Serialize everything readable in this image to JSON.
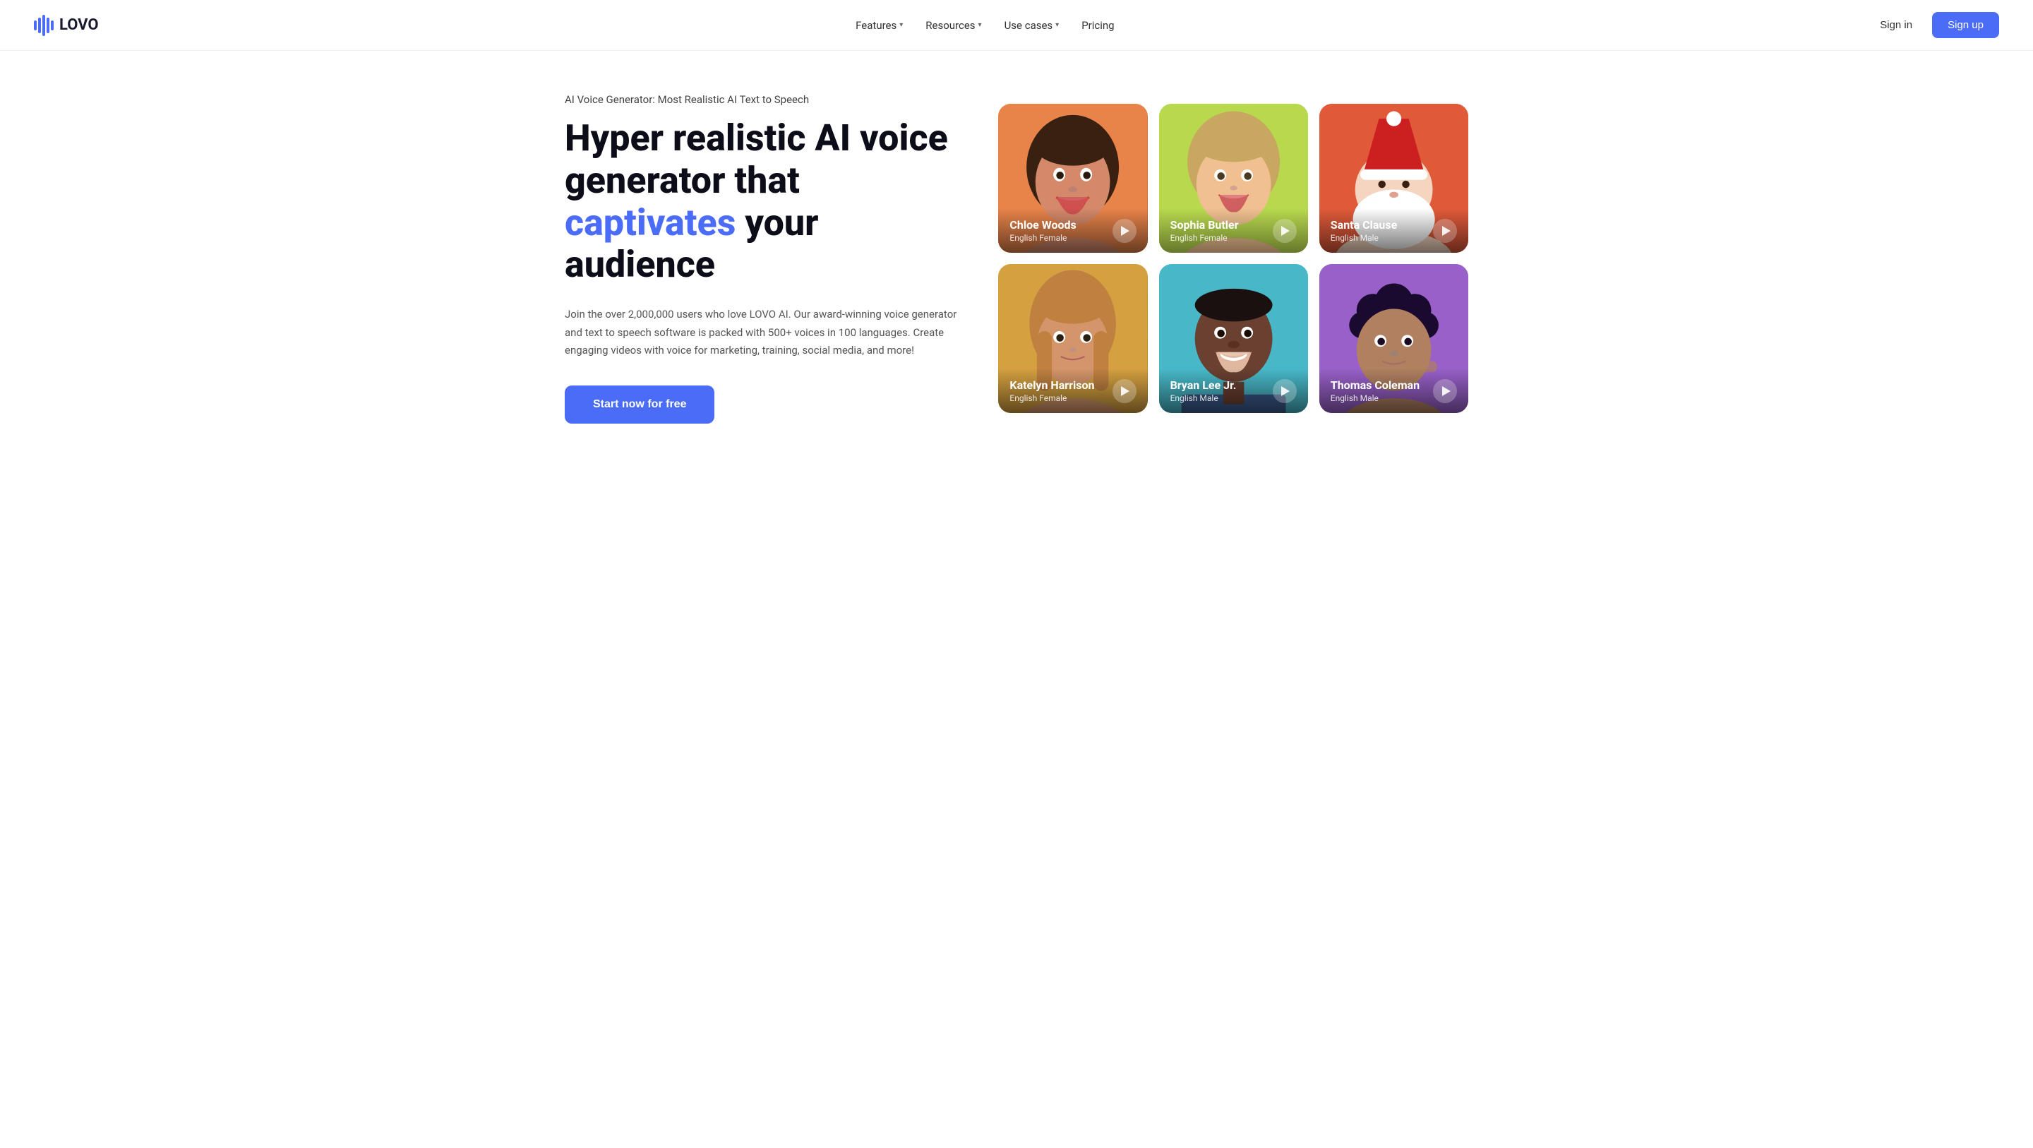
{
  "nav": {
    "logo_text": "LOVO",
    "links": [
      {
        "label": "Features",
        "has_dropdown": true
      },
      {
        "label": "Resources",
        "has_dropdown": true
      },
      {
        "label": "Use cases",
        "has_dropdown": true
      },
      {
        "label": "Pricing",
        "has_dropdown": false
      }
    ],
    "signin_label": "Sign in",
    "signup_label": "Sign up"
  },
  "hero": {
    "subtitle": "AI Voice Generator: Most Realistic AI Text to Speech",
    "title_part1": "Hyper realistic AI voice generator that ",
    "title_highlight": "captivates",
    "title_part2": " your audience",
    "description": "Join the over 2,000,000 users who love LOVO AI. Our award-winning voice generator and text to speech software is packed with 500+ voices in 100 languages. Create engaging videos with voice for marketing, training, social media, and more!",
    "cta_label": "Start now for free"
  },
  "voices": [
    {
      "id": "chloe",
      "name": "Chloe Woods",
      "lang": "English Female",
      "bg_class": "card-chloe",
      "emoji": "👩"
    },
    {
      "id": "sophia",
      "name": "Sophia Butler",
      "lang": "English Female",
      "bg_class": "card-sophia",
      "emoji": "👩‍🦳"
    },
    {
      "id": "santa",
      "name": "Santa Clause",
      "lang": "English Male",
      "bg_class": "card-santa",
      "emoji": "🎅"
    },
    {
      "id": "katelyn",
      "name": "Katelyn Harrison",
      "lang": "English Female",
      "bg_class": "card-katelyn",
      "emoji": "👱‍♀️"
    },
    {
      "id": "bryan",
      "name": "Bryan Lee Jr.",
      "lang": "English Male",
      "bg_class": "card-bryan",
      "emoji": "👨"
    },
    {
      "id": "thomas",
      "name": "Thomas Coleman",
      "lang": "English Male",
      "bg_class": "card-thomas",
      "emoji": "🧔"
    }
  ]
}
